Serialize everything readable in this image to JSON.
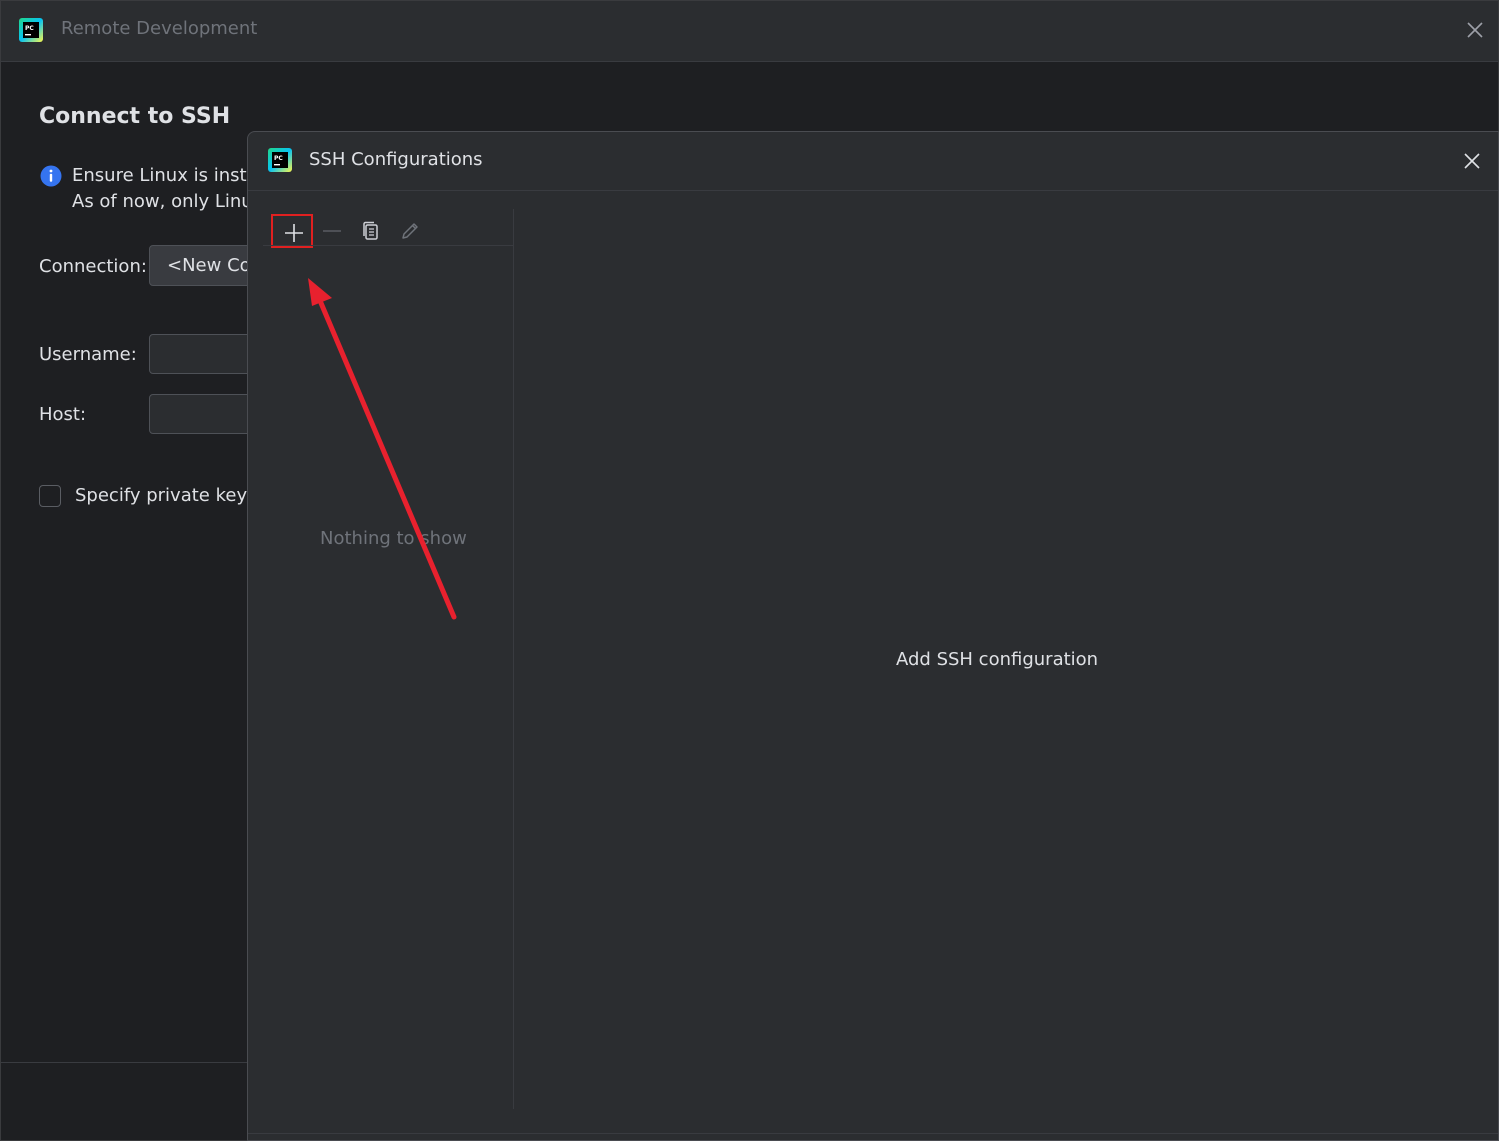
{
  "window": {
    "title": "Remote Development",
    "logo_text": "PC"
  },
  "main": {
    "heading": "Connect to SSH",
    "info_line1": "Ensure Linux is instal",
    "info_line2": "As of now, only Linux",
    "connection_label": "Connection:",
    "connection_value": "<New Cor",
    "username_label": "Username:",
    "username_value": "",
    "host_label": "Host:",
    "host_value": "",
    "private_key_label": "Specify private key",
    "private_key_checked": false
  },
  "dialog": {
    "title": "SSH Configurations",
    "logo_text": "PC",
    "toolbar": {
      "add_icon": "plus-icon",
      "remove_icon": "minus-icon",
      "copy_icon": "copy-icon",
      "edit_icon": "pencil-icon"
    },
    "empty_list_text": "Nothing to show",
    "empty_detail_text": "Add SSH configuration"
  },
  "annotation": {
    "highlight_color": "#e02020",
    "arrow_color": "#e8212e"
  },
  "colors": {
    "background": "#1e1f22",
    "dialog_background": "#2b2d30",
    "text": "#dfe1e5",
    "muted_text": "#6f737a",
    "info_blue": "#3574f0"
  }
}
